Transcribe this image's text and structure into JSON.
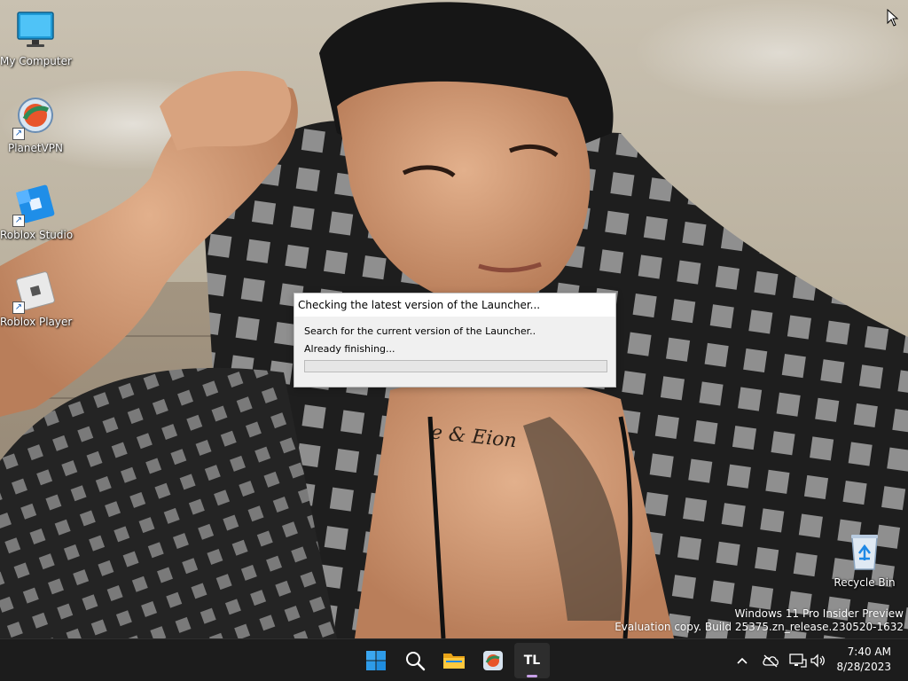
{
  "desktop": {
    "icons": [
      {
        "label": "My Computer",
        "icon": "monitor-icon"
      },
      {
        "label": "PlanetVPN",
        "icon": "planetvpn-icon"
      },
      {
        "label": "Roblox Studio",
        "icon": "roblox-studio-icon"
      },
      {
        "label": "Roblox Player",
        "icon": "roblox-player-icon"
      },
      {
        "label": "Recycle Bin",
        "icon": "recycle-bin-icon"
      }
    ]
  },
  "dialog": {
    "title": "Checking the latest version of the Launcher...",
    "line1": "Search for the current version of the Launcher..",
    "line2": "Already finishing...",
    "progress": 0
  },
  "watermark": {
    "line1": "Windows 11 Pro Insider Preview",
    "line2": "Evaluation copy. Build 25375.zn_release.230520-1632"
  },
  "taskbar": {
    "apps": [
      {
        "name": "start-button",
        "icon": "windows-logo-icon"
      },
      {
        "name": "search-button",
        "icon": "search-icon"
      },
      {
        "name": "file-explorer-button",
        "icon": "folder-icon"
      },
      {
        "name": "planetvpn-taskbar-button",
        "icon": "planetvpn-icon"
      },
      {
        "name": "tl-launcher-taskbar-button",
        "icon": "tl-icon",
        "label": "TL"
      }
    ],
    "tray": {
      "time": "7:40 AM",
      "date": "8/28/2023",
      "icons": [
        "chevron-up-icon",
        "cloud-off-icon",
        "network-icon",
        "volume-icon"
      ]
    }
  },
  "colors": {
    "taskbar_bg": "#1c1c1c",
    "accent_blue": "#0078d4",
    "progress_green": "#06b025"
  }
}
